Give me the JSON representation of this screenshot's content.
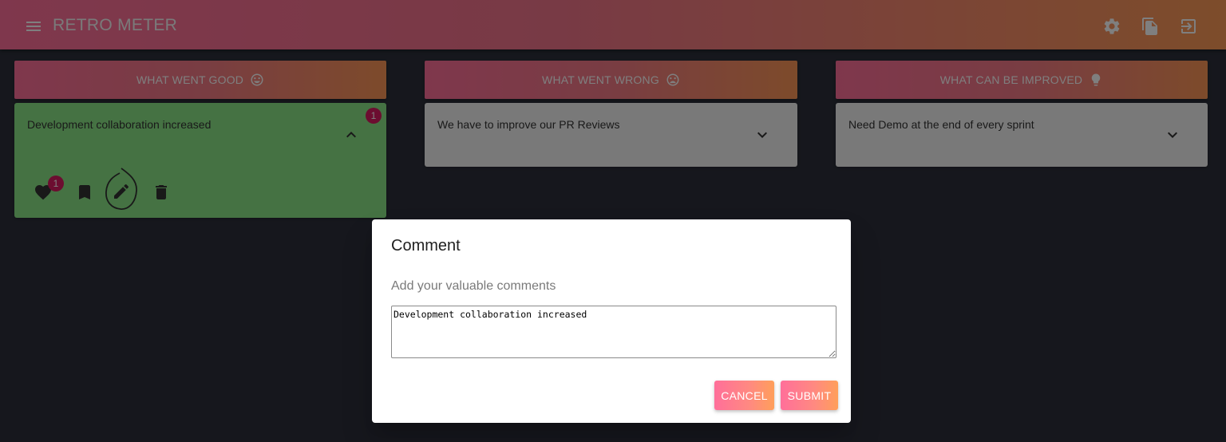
{
  "app": {
    "title": "RETRO METER",
    "icons": [
      "menu-icon",
      "settings-icon",
      "copy-icon",
      "exit-icon"
    ]
  },
  "columns": [
    {
      "header": "WHAT WENT GOOD",
      "header_icon": "smile-icon",
      "cards": [
        {
          "text": "Development collaboration increased",
          "comment_count": "1",
          "like_count": "1",
          "expanded": true,
          "color": "#8be587",
          "actions": [
            "heart-icon",
            "bookmark-icon",
            "edit-icon",
            "delete-icon"
          ]
        }
      ]
    },
    {
      "header": "WHAT WENT WRONG",
      "header_icon": "frown-icon",
      "cards": [
        {
          "text": "We have to improve our PR Reviews",
          "expanded": false,
          "color": "#f2f2f2"
        }
      ]
    },
    {
      "header": "WHAT CAN BE IMPROVED",
      "header_icon": "lightbulb-icon",
      "cards": [
        {
          "text": "Need Demo at the end of every sprint",
          "expanded": false,
          "color": "#f2f2f2"
        }
      ]
    }
  ],
  "dialog": {
    "title": "Comment",
    "subtitle": "Add your valuable comments",
    "textarea_value": "Development collaboration increased",
    "cancel_label": "CANCEL",
    "submit_label": "SUBMIT"
  },
  "colors": {
    "gradient_start": "#ff6f9a",
    "gradient_end": "#fb9a56",
    "badge": "#d81b60",
    "good_card": "#8be587",
    "background": "#2c2f3a"
  }
}
